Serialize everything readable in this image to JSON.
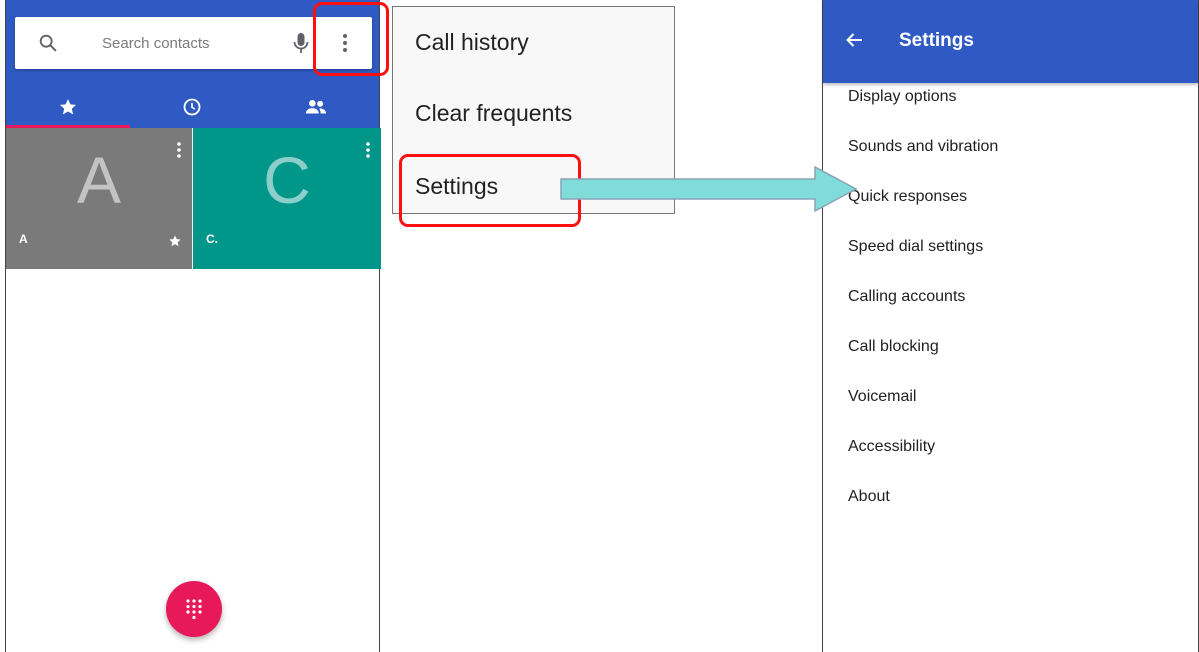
{
  "phone_app": {
    "search": {
      "placeholder": "Search contacts",
      "icon": "search-icon"
    },
    "mic_icon": "mic-icon",
    "more_icon": "more-vert-icon",
    "tabs": [
      {
        "icon": "star-icon",
        "selected": true
      },
      {
        "icon": "clock-icon",
        "selected": false
      },
      {
        "icon": "people-icon",
        "selected": false
      }
    ],
    "favorites": [
      {
        "letter": "A",
        "name": "A",
        "starred": true,
        "color": "#7a7a7a"
      },
      {
        "letter": "C",
        "name": "C.",
        "starred": false,
        "color": "#00968a"
      }
    ],
    "fab_icon": "dialpad-icon",
    "accent_color": "#e8195a",
    "brand_color": "#2f5ac4"
  },
  "overflow_menu": {
    "items": [
      "Call history",
      "Clear frequents",
      "Settings"
    ]
  },
  "settings": {
    "title": "Settings",
    "back_icon": "back-arrow-icon",
    "items": [
      "Display options",
      "Sounds and vibration",
      "Quick responses",
      "Speed dial settings",
      "Calling accounts",
      "Call blocking",
      "Voicemail",
      "Accessibility",
      "About"
    ]
  },
  "annotations": {
    "highlight_color": "#ff1010",
    "arrow_color": "#7fdcd8"
  }
}
